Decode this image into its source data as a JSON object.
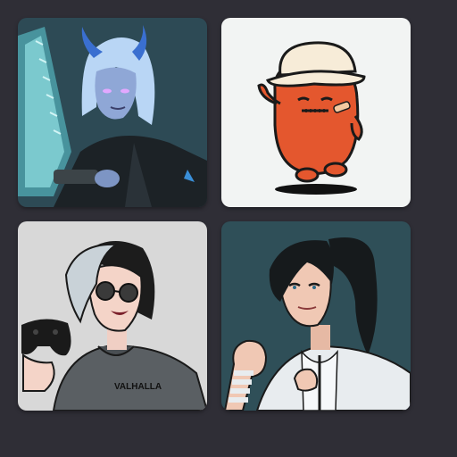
{
  "avatars": [
    {
      "id": "avatar-demon-chainsaw",
      "background": "#2d4a55"
    },
    {
      "id": "avatar-orange-blob",
      "background": "#f2f4f3"
    },
    {
      "id": "avatar-gamer-sunglasses",
      "background": "#d8d8d8",
      "hoodie_text": "VALHALLA"
    },
    {
      "id": "avatar-fighter-ponytail",
      "background": "#2f4f58"
    }
  ],
  "colors": {
    "page_background": "#2f2e36",
    "blob_orange": "#e4572e",
    "demon_skin": "#8fa7d6",
    "demon_hair": "#b9d6f5"
  }
}
